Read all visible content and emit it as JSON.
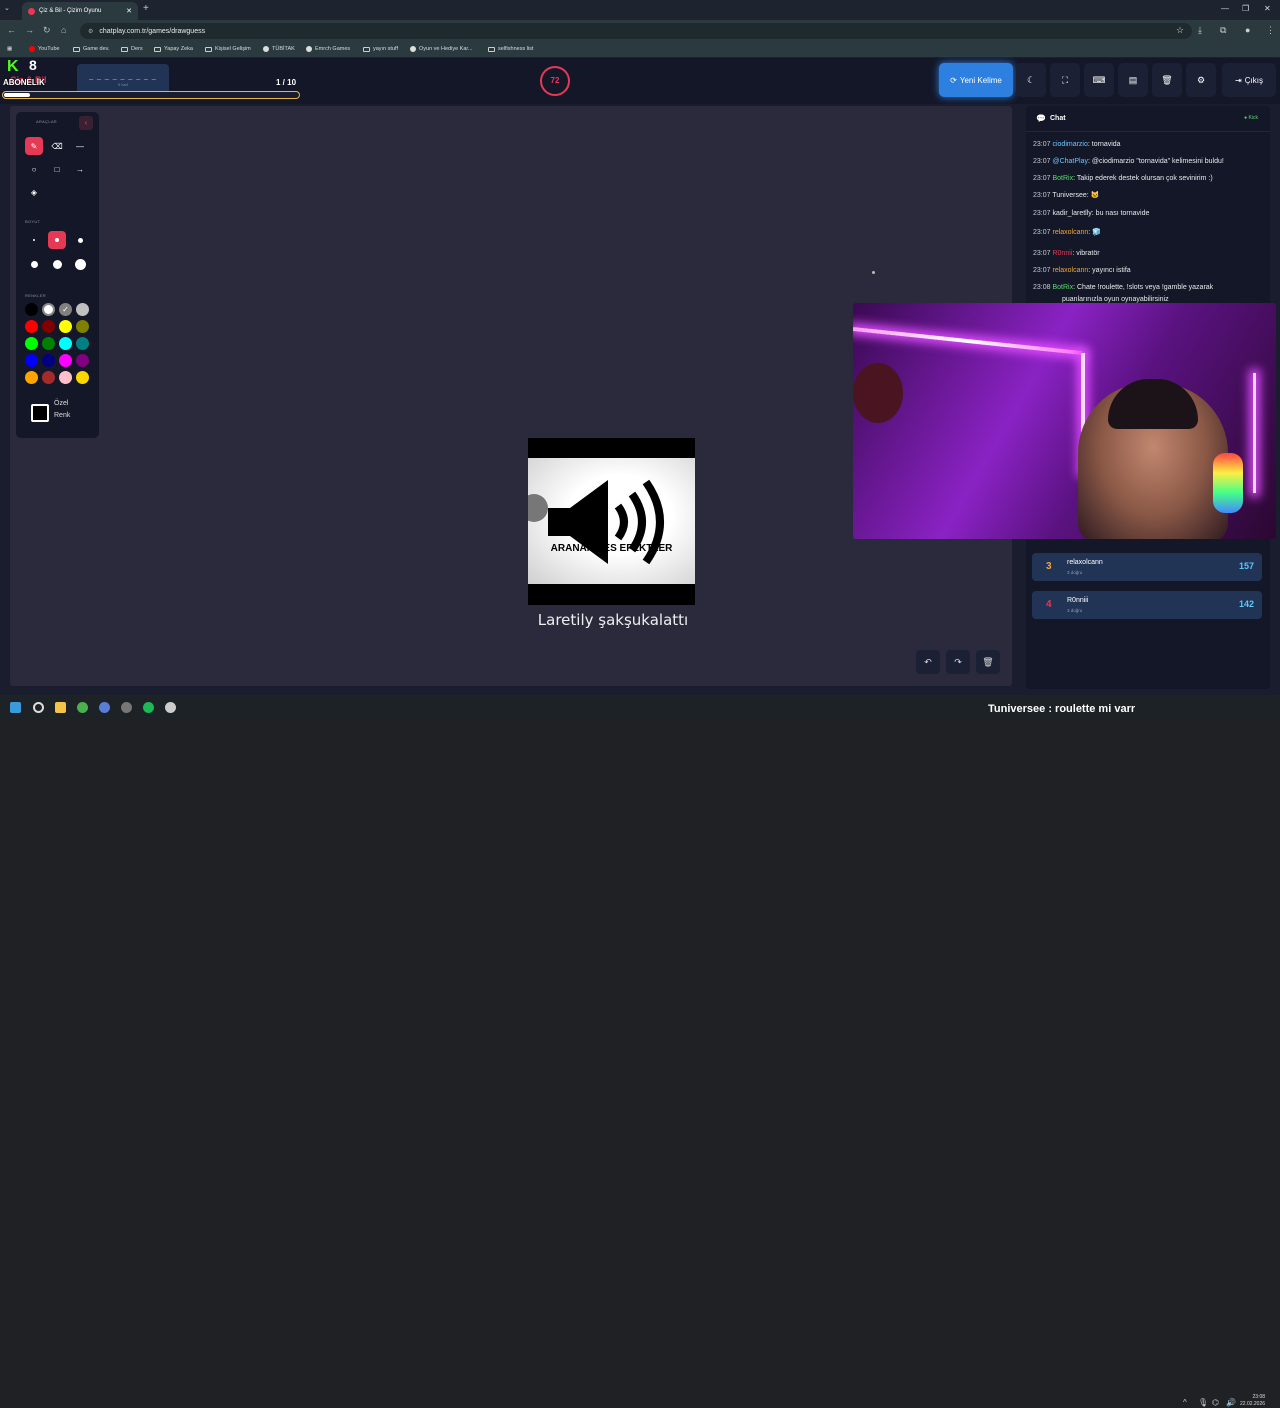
{
  "browser": {
    "tab_title": "Çiz & Bil - Çizim Oyunu",
    "tab_close": "✕",
    "new_tab": "+",
    "url": "chatplay.com.tr/games/drawguess",
    "bookmarks": [
      "YouTube",
      "Game dev.",
      "Ders",
      "Yapay Zeka",
      "Kişisel Gelişim",
      "TÜBİTAK",
      "Emrch Games",
      "yayın stuff",
      "Oyun ve Hediye Kar...",
      "selfishness list"
    ]
  },
  "header": {
    "logo": "Çiz & Bil",
    "overlay_label": "ABONELİK",
    "word_hint": "_ _ _ _ _ _ _ _ _",
    "word_length": "9 harf",
    "round": "1 / 10",
    "progress_fraction": 0.09,
    "timer": "72",
    "new_word": "Yeni Kelime",
    "logout": "Çıkış"
  },
  "tools": {
    "section_tools": "ARAÇLAR",
    "section_size": "BOYUT",
    "section_colors": "RENKLER",
    "custom_color": "Özel Renk",
    "kick_letter": "K",
    "kick_count": "8",
    "colors": [
      "#000000",
      "#ffffff",
      "#808080",
      "#c0c0c0",
      "#ff0000",
      "#800000",
      "#ffff00",
      "#808000",
      "#00ff00",
      "#008000",
      "#00ffff",
      "#008080",
      "#0000ff",
      "#000080",
      "#ff00ff",
      "#800080",
      "#ffa500",
      "#a52a2a",
      "#ffc0cb",
      "#ffd700"
    ]
  },
  "canvas": {
    "sound_text": "ARANAN SES EFEKTLER",
    "caption": "Laretily şakşukalattı"
  },
  "chat": {
    "title": "Chat",
    "badge": "Kick",
    "messages": [
      {
        "time": "23:07",
        "user": "ciodimarzio",
        "color": "#6ec6ff",
        "text": ": tornavida"
      },
      {
        "time": "23:07",
        "user": "@ChatPlay",
        "color": "#6ec6ff",
        "text": ": @ciodimarzio \"tornavida\" kelimesini buldu!"
      },
      {
        "time": "23:07",
        "user": "BotRix",
        "color": "#5bdc6a",
        "text": ": Takip ederek destek olursan çok sevinirim :)"
      },
      {
        "time": "23:07",
        "user": "Tuniversee",
        "color": "#e8eaed",
        "text": ": 🐱"
      },
      {
        "time": "23:07",
        "user": "kadir_laretlly",
        "color": "#e8eaed",
        "text": ": bu nası tornavide"
      },
      {
        "time": "23:07",
        "user": "relaxolcann",
        "color": "#f0a63a",
        "text": ": 🧊"
      },
      {
        "time": "23:07",
        "user": "R0nnii",
        "color": "#e53956",
        "text": ": vibratör"
      },
      {
        "time": "23:07",
        "user": "relaxolcann",
        "color": "#f0a63a",
        "text": ": yayıncı istifa"
      },
      {
        "time": "23:08",
        "user": "BotRix",
        "color": "#5bdc6a",
        "text": ": Chate !roulette, !slots veya !gamble yazarak"
      }
    ],
    "message_cont": "puanlarınızla oyun oynayabilirsiniz"
  },
  "leaderboard": [
    {
      "rank": "3",
      "rank_color": "#f0a63a",
      "name": "relaxolcann",
      "sub": "3 doğru",
      "score": "157"
    },
    {
      "rank": "4",
      "rank_color": "#e53956",
      "name": "R0nniii",
      "sub": "3 doğru",
      "score": "142"
    }
  ],
  "taskbar": {
    "overlay_text": "Tuniversee : roulette mi varr",
    "time": "23:08",
    "date": "22.02.2026"
  }
}
